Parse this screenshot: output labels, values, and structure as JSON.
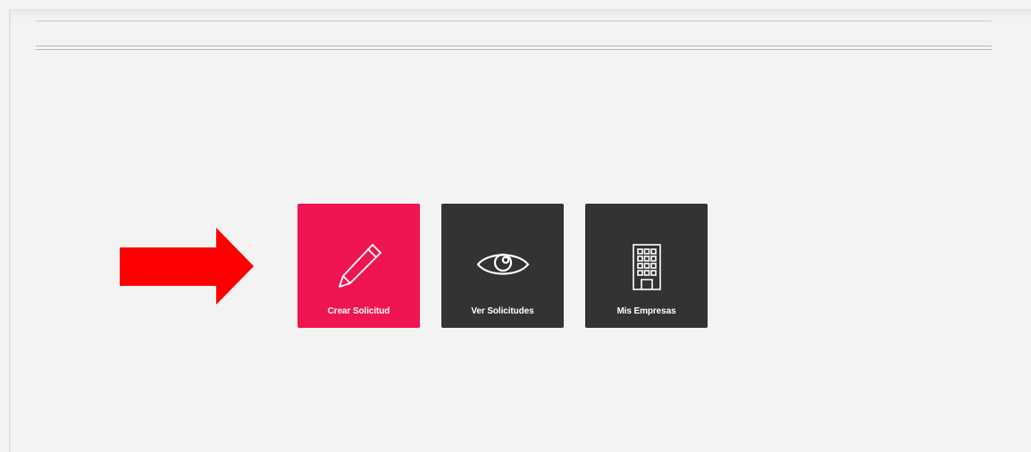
{
  "arrow": {
    "color": "#ff0000",
    "icon": "right-arrow-icon"
  },
  "tiles": [
    {
      "label": "Crear Solicitud",
      "icon": "pencil-icon",
      "color": "#ee1550"
    },
    {
      "label": "Ver Solicitudes",
      "icon": "eye-icon",
      "color": "#333333"
    },
    {
      "label": "Mis Empresas",
      "icon": "building-icon",
      "color": "#333333"
    }
  ]
}
